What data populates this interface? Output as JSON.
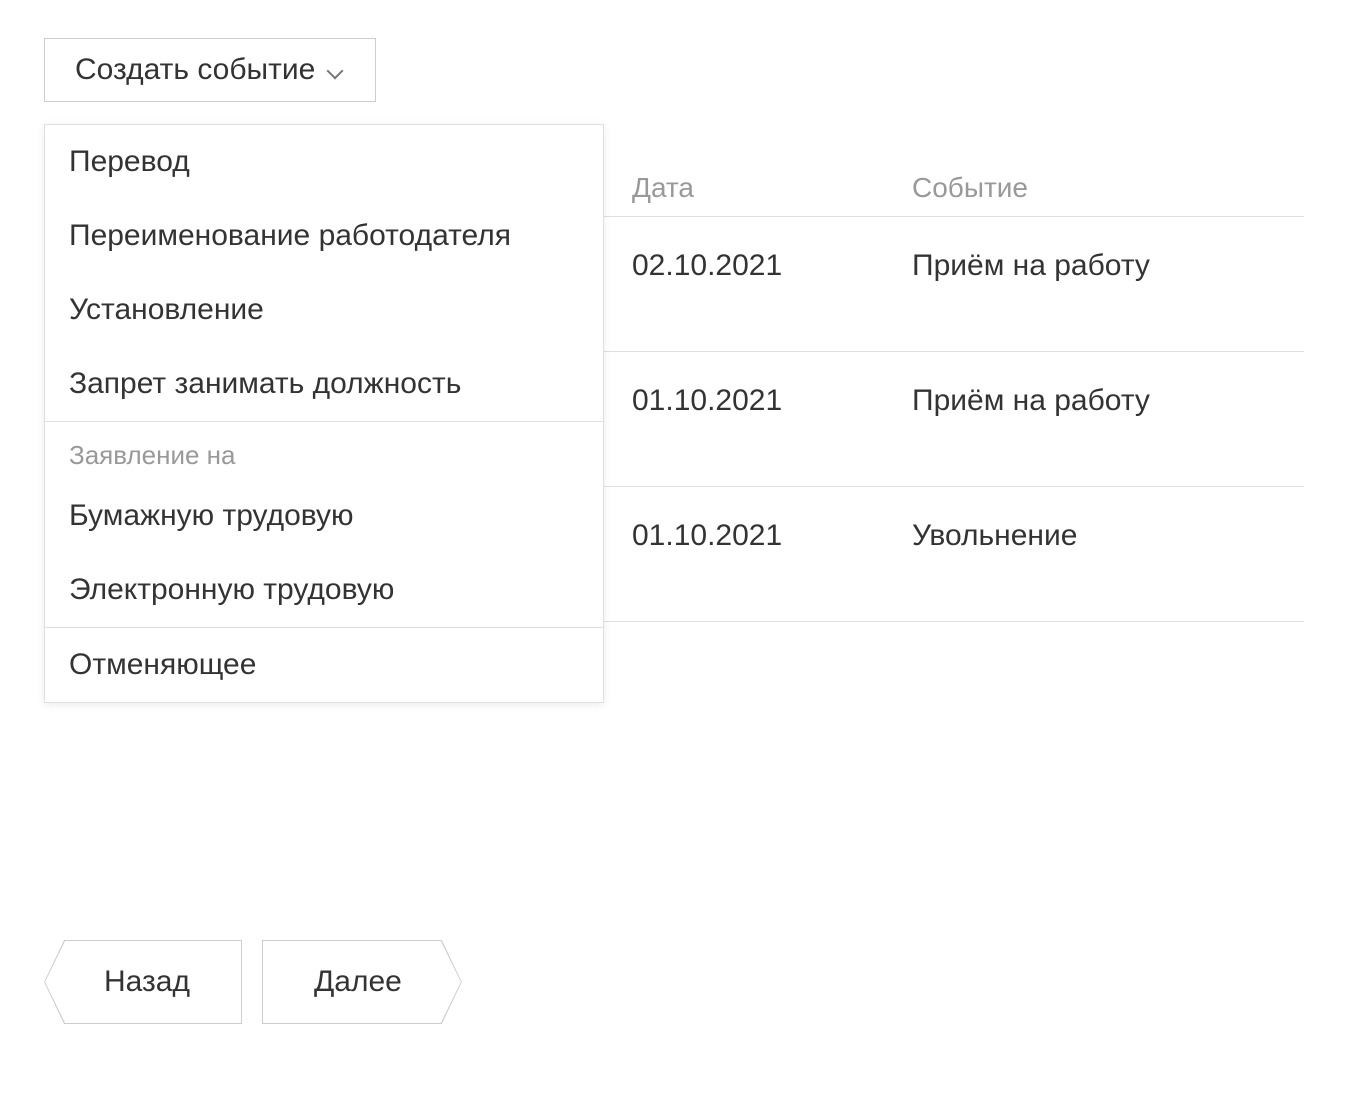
{
  "dropdown": {
    "label": "Создать событие",
    "group1": [
      "Перевод",
      "Переименование работодателя",
      "Установление",
      "Запрет занимать должность"
    ],
    "group2_label": "Заявление на",
    "group2": [
      "Бумажную трудовую",
      "Электронную трудовую"
    ],
    "group3": [
      "Отменяющее"
    ]
  },
  "table": {
    "headers": {
      "date": "Дата",
      "event": "Событие"
    },
    "rows": [
      {
        "date": "02.10.2021",
        "event": "Приём на работу"
      },
      {
        "date": "01.10.2021",
        "event": "Приём на работу"
      },
      {
        "date": "01.10.2021",
        "event": "Увольнение"
      }
    ]
  },
  "footer": {
    "back": "Назад",
    "next": "Далее"
  }
}
